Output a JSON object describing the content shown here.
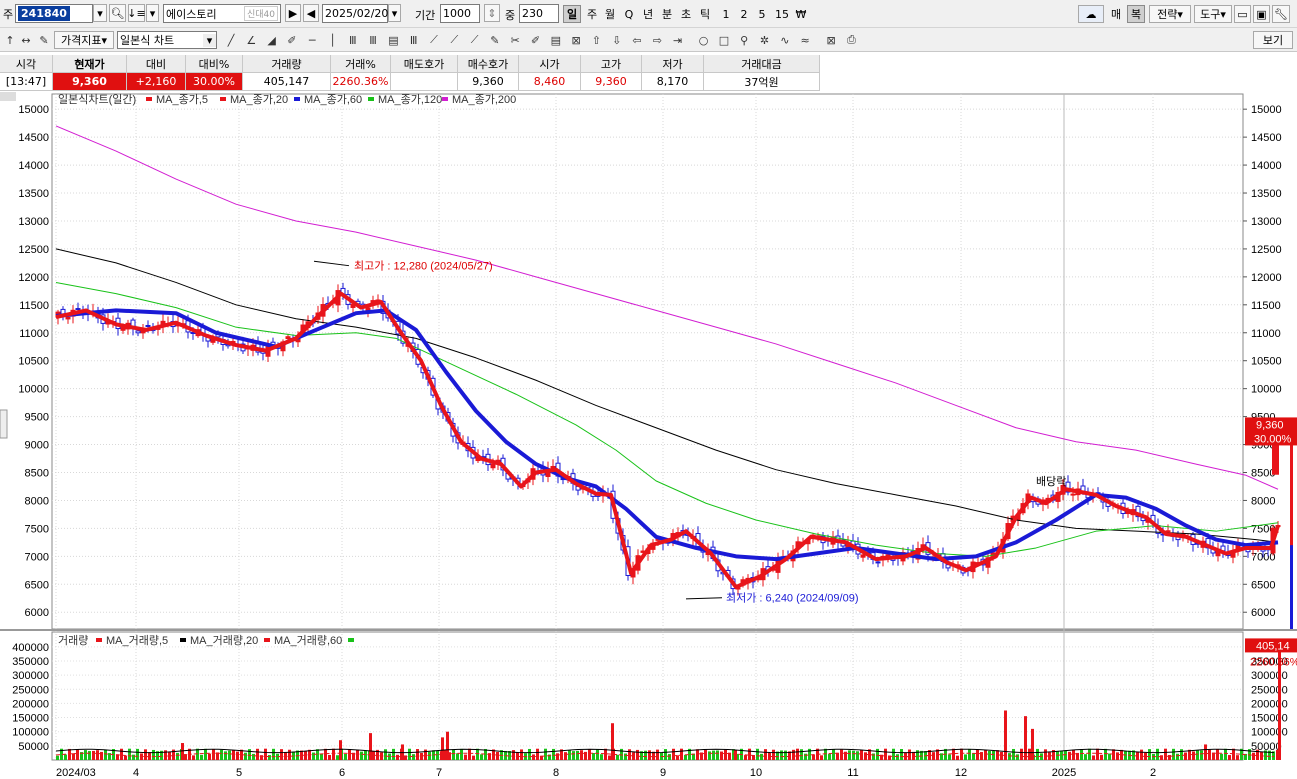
{
  "toolbar": {
    "code_label": "주",
    "code": "241840",
    "name": "에이스토리",
    "badge": "신대40",
    "date": "2025/02/20",
    "period_label": "기간",
    "period": "1000",
    "zoom_label": "중",
    "zoom": "230",
    "intervals": [
      "일",
      "주",
      "월",
      "Q",
      "년",
      "분",
      "초",
      "틱",
      "1",
      "2",
      "5",
      "15",
      "₩"
    ],
    "active_interval": "일",
    "right_buttons": [
      "매",
      "복",
      "전략",
      "도구"
    ],
    "indicator_label": "가격지표",
    "chart_type": "일본식 차트",
    "view_label": "보기"
  },
  "quote": {
    "headers": [
      "시각",
      "현재가",
      "대비",
      "대비%",
      "거래량",
      "거래%",
      "매도호가",
      "매수호가",
      "시가",
      "고가",
      "저가",
      "거래대금"
    ],
    "values": [
      "[13:47]",
      "9,360",
      "+2,160",
      "30.00%",
      "405,147",
      "2260.36%",
      "",
      "9,360",
      "8,460",
      "9,360",
      "8,170",
      "37억원"
    ]
  },
  "chart_data": {
    "type": "candlestick",
    "title": "일본식차트(일간)",
    "legend": [
      {
        "name": "MA_종가,5",
        "color": "#e8141a"
      },
      {
        "name": "MA_종가,20",
        "color": "#e8141a"
      },
      {
        "name": "MA_종가,60",
        "color": "#1a1ad6"
      },
      {
        "name": "MA_종가,120",
        "color": "#19c219"
      },
      {
        "name": "MA_종가,200",
        "color": "#d21ed2"
      }
    ],
    "ylim": [
      5700,
      15200
    ],
    "yticks": [
      6000,
      6500,
      7000,
      7500,
      8000,
      8500,
      9000,
      9500,
      10000,
      10500,
      11000,
      11500,
      12000,
      12500,
      13000,
      13500,
      14000,
      14500,
      15000
    ],
    "xticks": [
      "2024/03",
      "4",
      "5",
      "6",
      "7",
      "8",
      "9",
      "10",
      "11",
      "12",
      "2025",
      "2"
    ],
    "annotations": {
      "high": "최고가 : 12,280 (2024/05/27)",
      "low": "최저가 : 6,240 (2024/09/09)",
      "event": "배당락"
    },
    "last_price_label": "9,360",
    "last_change_label": "30.00%",
    "ma5": [
      [
        0,
        11280
      ],
      [
        30,
        11400
      ],
      [
        60,
        11150
      ],
      [
        90,
        11050
      ],
      [
        120,
        11180
      ],
      [
        150,
        10950
      ],
      [
        180,
        10780
      ],
      [
        210,
        10680
      ],
      [
        240,
        10900
      ],
      [
        265,
        11350
      ],
      [
        285,
        11700
      ],
      [
        305,
        11450
      ],
      [
        325,
        11550
      ],
      [
        345,
        11000
      ],
      [
        365,
        10500
      ],
      [
        385,
        9700
      ],
      [
        405,
        9050
      ],
      [
        425,
        8750
      ],
      [
        445,
        8650
      ],
      [
        465,
        8250
      ],
      [
        480,
        8500
      ],
      [
        500,
        8550
      ],
      [
        520,
        8300
      ],
      [
        540,
        8120
      ],
      [
        555,
        8100
      ],
      [
        575,
        6700
      ],
      [
        595,
        7200
      ],
      [
        615,
        7300
      ],
      [
        630,
        7450
      ],
      [
        655,
        7050
      ],
      [
        680,
        6450
      ],
      [
        705,
        6650
      ],
      [
        730,
        6950
      ],
      [
        755,
        7350
      ],
      [
        790,
        7250
      ],
      [
        820,
        6950
      ],
      [
        850,
        7000
      ],
      [
        870,
        7150
      ],
      [
        890,
        6900
      ],
      [
        910,
        6750
      ],
      [
        940,
        7000
      ],
      [
        960,
        7700
      ],
      [
        975,
        8050
      ],
      [
        990,
        7950
      ],
      [
        1010,
        8200
      ],
      [
        1040,
        8100
      ],
      [
        1060,
        7900
      ],
      [
        1090,
        7700
      ],
      [
        1110,
        7400
      ],
      [
        1130,
        7350
      ],
      [
        1150,
        7200
      ],
      [
        1170,
        7050
      ],
      [
        1190,
        7150
      ],
      [
        1215,
        7150
      ],
      [
        1222,
        7550
      ]
    ],
    "ma20": [
      [
        0,
        11300
      ],
      [
        60,
        11400
      ],
      [
        120,
        11350
      ],
      [
        160,
        11000
      ],
      [
        220,
        10750
      ],
      [
        260,
        11050
      ],
      [
        300,
        11350
      ],
      [
        330,
        11400
      ],
      [
        360,
        11050
      ],
      [
        390,
        10300
      ],
      [
        420,
        9600
      ],
      [
        450,
        9050
      ],
      [
        480,
        8650
      ],
      [
        510,
        8400
      ],
      [
        540,
        8250
      ],
      [
        570,
        7850
      ],
      [
        600,
        7350
      ],
      [
        640,
        7150
      ],
      [
        680,
        7000
      ],
      [
        720,
        6950
      ],
      [
        760,
        7050
      ],
      [
        800,
        7150
      ],
      [
        840,
        7050
      ],
      [
        880,
        6950
      ],
      [
        920,
        7000
      ],
      [
        960,
        7250
      ],
      [
        1000,
        7650
      ],
      [
        1040,
        8100
      ],
      [
        1070,
        8050
      ],
      [
        1100,
        7850
      ],
      [
        1130,
        7550
      ],
      [
        1160,
        7300
      ],
      [
        1190,
        7200
      ],
      [
        1222,
        7250
      ]
    ],
    "ma60": [
      [
        0,
        11900
      ],
      [
        60,
        11700
      ],
      [
        120,
        11450
      ],
      [
        180,
        11100
      ],
      [
        240,
        10950
      ],
      [
        300,
        11000
      ],
      [
        340,
        10900
      ],
      [
        400,
        10400
      ],
      [
        460,
        9900
      ],
      [
        520,
        9350
      ],
      [
        560,
        8900
      ],
      [
        600,
        8350
      ],
      [
        650,
        7950
      ],
      [
        700,
        7650
      ],
      [
        760,
        7400
      ],
      [
        820,
        7200
      ],
      [
        880,
        7050
      ],
      [
        930,
        7000
      ],
      [
        980,
        7150
      ],
      [
        1040,
        7450
      ],
      [
        1100,
        7550
      ],
      [
        1160,
        7450
      ],
      [
        1222,
        7600
      ]
    ],
    "ma120": [
      [
        0,
        12500
      ],
      [
        60,
        12250
      ],
      [
        120,
        11900
      ],
      [
        180,
        11500
      ],
      [
        240,
        11250
      ],
      [
        300,
        11100
      ],
      [
        360,
        10900
      ],
      [
        420,
        10550
      ],
      [
        480,
        10150
      ],
      [
        540,
        9700
      ],
      [
        600,
        9300
      ],
      [
        660,
        8900
      ],
      [
        720,
        8550
      ],
      [
        780,
        8300
      ],
      [
        840,
        8100
      ],
      [
        900,
        7900
      ],
      [
        960,
        7650
      ],
      [
        1020,
        7500
      ],
      [
        1080,
        7450
      ],
      [
        1140,
        7400
      ],
      [
        1200,
        7300
      ],
      [
        1222,
        7250
      ]
    ],
    "ma200": [
      [
        0,
        14700
      ],
      [
        60,
        14250
      ],
      [
        120,
        13750
      ],
      [
        180,
        13300
      ],
      [
        240,
        13000
      ],
      [
        300,
        12800
      ],
      [
        360,
        12550
      ],
      [
        420,
        12300
      ],
      [
        480,
        12000
      ],
      [
        540,
        11700
      ],
      [
        600,
        11400
      ],
      [
        660,
        11100
      ],
      [
        720,
        10800
      ],
      [
        780,
        10450
      ],
      [
        840,
        10100
      ],
      [
        900,
        9700
      ],
      [
        960,
        9300
      ],
      [
        1020,
        9050
      ],
      [
        1080,
        8900
      ],
      [
        1140,
        8650
      ],
      [
        1190,
        8450
      ],
      [
        1222,
        8200
      ]
    ],
    "volume": {
      "title": "거래량",
      "legend": [
        {
          "name": "MA_거래량,5",
          "color": "#e8141a"
        },
        {
          "name": "MA_거래량,20",
          "color": "#000000"
        },
        {
          "name": "MA_거래량,60",
          "color": "#e8141a"
        },
        {
          "name": "",
          "color": "#19c219"
        }
      ],
      "ylim": [
        0,
        410000
      ],
      "yticks": [
        50000,
        100000,
        150000,
        200000,
        250000,
        300000,
        350000,
        400000
      ],
      "last_volume_label": "405,14",
      "last_pct_label": "2260.36%",
      "spikes": [
        [
          125,
          60000
        ],
        [
          283,
          70000
        ],
        [
          313,
          95000
        ],
        [
          345,
          55000
        ],
        [
          385,
          80000
        ],
        [
          390,
          100000
        ],
        [
          555,
          130000
        ],
        [
          678,
          35000
        ],
        [
          740,
          40000
        ],
        [
          948,
          175000
        ],
        [
          968,
          155000
        ],
        [
          975,
          110000
        ],
        [
          1148,
          55000
        ],
        [
          1222,
          405000
        ]
      ]
    }
  }
}
